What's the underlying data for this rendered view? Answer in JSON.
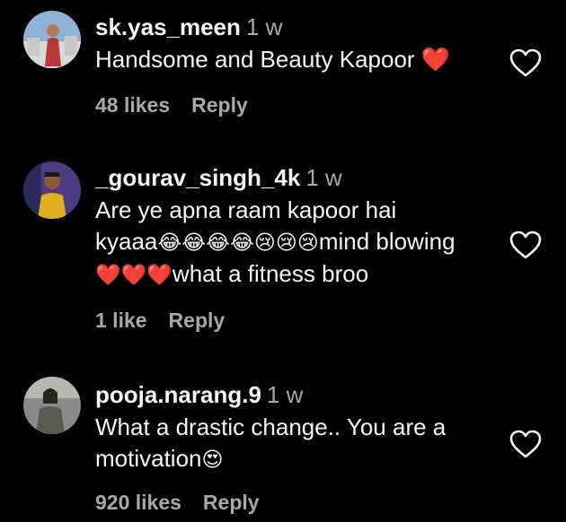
{
  "comments": [
    {
      "username": "sk.yas_meen",
      "time": "1 w",
      "lines": [
        "Handsome and Beauty Kapoor ❤️"
      ],
      "likes": "48 likes",
      "reply": "Reply",
      "avatar_bg": "#6d8aa8"
    },
    {
      "username": "_gourav_singh_4k",
      "time": "1 w",
      "line1": "Are ye apna raam kapoor hai",
      "line2_text": "kyaaa",
      "line2_emoji": "😂😂😂😂😢😢😢",
      "line2_tail": "mind blowing",
      "line3_emoji": "❤️❤️❤️",
      "line3_text": "what a fitness broo",
      "likes": "1 like",
      "reply": "Reply",
      "avatar_bg": "#5a4a8a"
    },
    {
      "username": "pooja.narang.9",
      "time": "1 w",
      "line1": "What a drastic change.. You are a",
      "line2_text": "motivation",
      "line2_emoji": "😍",
      "likes": "920 likes",
      "reply": "Reply",
      "avatar_bg": "#7a7a7a"
    }
  ],
  "icons": {
    "like": "heart-outline-icon"
  },
  "colors": {
    "background": "#000000",
    "primary_text": "#f5f5f5",
    "secondary_text": "#a8a8a8",
    "heart_red": "#e8313c"
  }
}
